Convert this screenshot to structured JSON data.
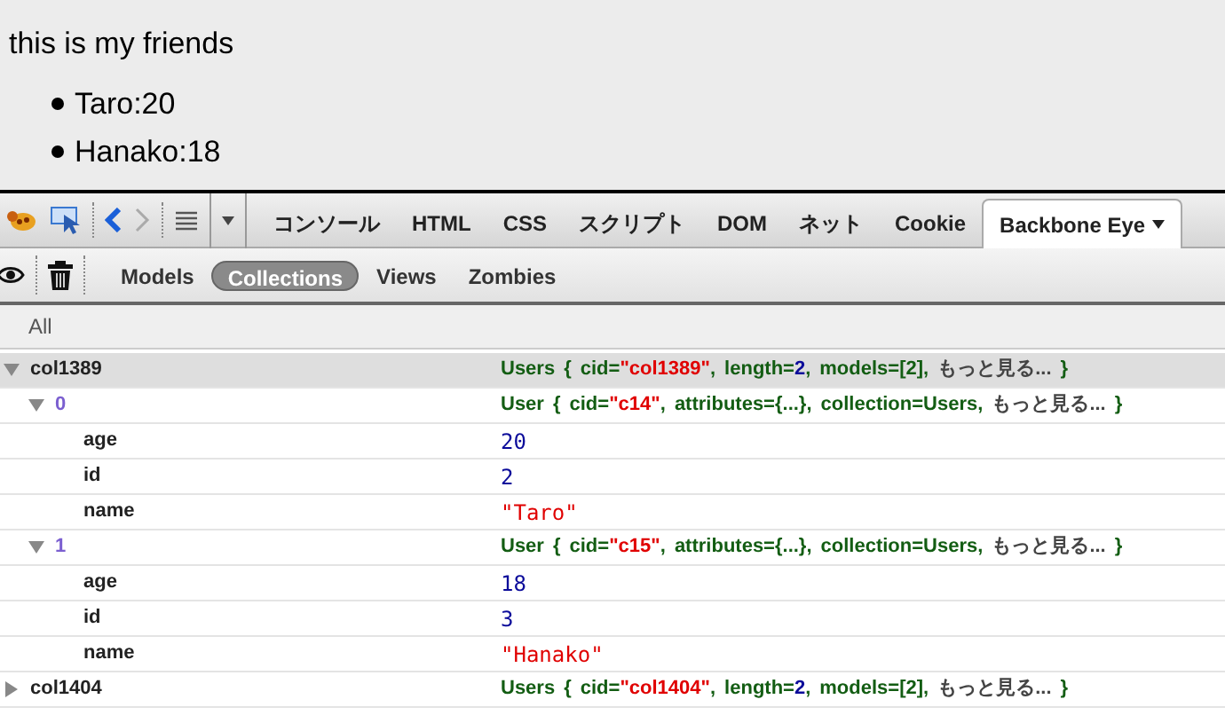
{
  "page": {
    "heading": "this is my friends",
    "items": [
      "Taro:20",
      "Hanako:18"
    ]
  },
  "toolbar": {
    "tabs": [
      {
        "label": "コンソール",
        "selected": false
      },
      {
        "label": "HTML",
        "selected": false
      },
      {
        "label": "CSS",
        "selected": false
      },
      {
        "label": "スクリプト",
        "selected": false
      },
      {
        "label": "DOM",
        "selected": false
      },
      {
        "label": "ネット",
        "selected": false
      },
      {
        "label": "Cookie",
        "selected": false
      },
      {
        "label": "Backbone Eye",
        "selected": true
      }
    ]
  },
  "subtabs": [
    {
      "label": "Models",
      "selected": false
    },
    {
      "label": "Collections",
      "selected": true
    },
    {
      "label": "Views",
      "selected": false
    },
    {
      "label": "Zombies",
      "selected": false
    }
  ],
  "filter": "All",
  "tree": [
    {
      "name": "col1389",
      "expanded": true,
      "selected": true,
      "summary": [
        {
          "kind": "plain",
          "text": "Users"
        },
        {
          "kind": "plain",
          "text": "{"
        },
        {
          "kind": "key",
          "text": "cid="
        },
        {
          "kind": "string",
          "text": "\"col1389\""
        },
        {
          "kind": "sep",
          "text": ","
        },
        {
          "kind": "key",
          "text": "length="
        },
        {
          "kind": "number",
          "text": "2"
        },
        {
          "kind": "sep",
          "text": ","
        },
        {
          "kind": "plain",
          "text": "models=[2]"
        },
        {
          "kind": "sep",
          "text": ","
        },
        {
          "kind": "more",
          "text": "もっと見る..."
        },
        {
          "kind": "plain",
          "text": "}"
        }
      ],
      "children": [
        {
          "name": "0",
          "expanded": true,
          "summary": [
            {
              "kind": "plain",
              "text": "User"
            },
            {
              "kind": "plain",
              "text": "{"
            },
            {
              "kind": "key",
              "text": "cid="
            },
            {
              "kind": "string",
              "text": "\"c14\""
            },
            {
              "kind": "sep",
              "text": ","
            },
            {
              "kind": "plain",
              "text": "attributes={...}"
            },
            {
              "kind": "sep",
              "text": ","
            },
            {
              "kind": "plain",
              "text": "collection=Users"
            },
            {
              "kind": "sep",
              "text": ","
            },
            {
              "kind": "more",
              "text": "もっと見る..."
            },
            {
              "kind": "plain",
              "text": "}"
            }
          ],
          "children": [
            {
              "name": "age",
              "kind": "number",
              "value": "20"
            },
            {
              "name": "id",
              "kind": "number",
              "value": "2"
            },
            {
              "name": "name",
              "kind": "string",
              "value": "\"Taro\""
            }
          ]
        },
        {
          "name": "1",
          "expanded": true,
          "summary": [
            {
              "kind": "plain",
              "text": "User"
            },
            {
              "kind": "plain",
              "text": "{"
            },
            {
              "kind": "key",
              "text": "cid="
            },
            {
              "kind": "string",
              "text": "\"c15\""
            },
            {
              "kind": "sep",
              "text": ","
            },
            {
              "kind": "plain",
              "text": "attributes={...}"
            },
            {
              "kind": "sep",
              "text": ","
            },
            {
              "kind": "plain",
              "text": "collection=Users"
            },
            {
              "kind": "sep",
              "text": ","
            },
            {
              "kind": "more",
              "text": "もっと見る..."
            },
            {
              "kind": "plain",
              "text": "}"
            }
          ],
          "children": [
            {
              "name": "age",
              "kind": "number",
              "value": "18"
            },
            {
              "name": "id",
              "kind": "number",
              "value": "3"
            },
            {
              "name": "name",
              "kind": "string",
              "value": "\"Hanako\""
            }
          ]
        }
      ]
    },
    {
      "name": "col1404",
      "expanded": false,
      "selected": false,
      "summary": [
        {
          "kind": "plain",
          "text": "Users"
        },
        {
          "kind": "plain",
          "text": "{"
        },
        {
          "kind": "key",
          "text": "cid="
        },
        {
          "kind": "string",
          "text": "\"col1404\""
        },
        {
          "kind": "sep",
          "text": ","
        },
        {
          "kind": "key",
          "text": "length="
        },
        {
          "kind": "number",
          "text": "2"
        },
        {
          "kind": "sep",
          "text": ","
        },
        {
          "kind": "plain",
          "text": "models=[2]"
        },
        {
          "kind": "sep",
          "text": ","
        },
        {
          "kind": "more",
          "text": "もっと見る..."
        },
        {
          "kind": "plain",
          "text": "}"
        }
      ]
    }
  ]
}
